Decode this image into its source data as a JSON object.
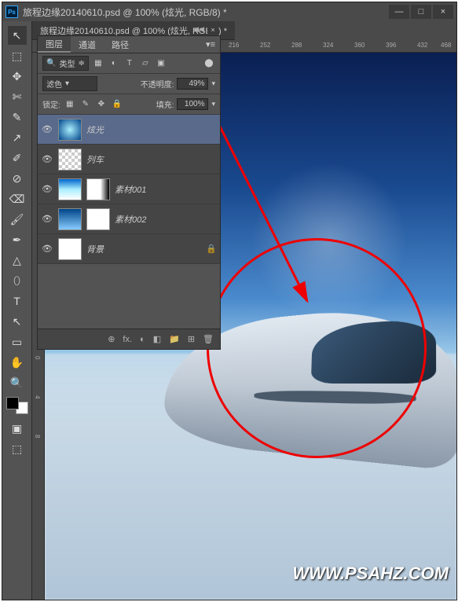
{
  "titlebar": {
    "app": "Ps",
    "title": "旅程边缘20140610.psd @ 100% (炫光, RGB/8) *"
  },
  "window_buttons": {
    "min": "—",
    "max": "□",
    "close": "×"
  },
  "tab_title": "旅程边缘20140610.psd @ 100% (炫光, RGB/8) *",
  "ruler_marks_h": [
    "216",
    "252",
    "288",
    "324",
    "360",
    "396",
    "432",
    "468"
  ],
  "ruler_marks_v": [
    "0",
    "4",
    "8"
  ],
  "panel": {
    "tabs": {
      "layers": "图层",
      "channels": "通道",
      "paths": "路径"
    },
    "filter_label": "类型",
    "filter_icon": "🔍",
    "blend_mode": "滤色",
    "opacity_label": "不透明度:",
    "opacity_value": "49%",
    "lock_label": "锁定:",
    "fill_label": "填充:",
    "fill_value": "100%",
    "layers": [
      {
        "name": "炫光",
        "selected": true
      },
      {
        "name": "列车"
      },
      {
        "name": "素材001"
      },
      {
        "name": "素材002"
      },
      {
        "name": "背景",
        "locked": true
      }
    ],
    "footer_icons": [
      "⊕",
      "fx.",
      "◐",
      "◧",
      "▣",
      "📁",
      "⊞",
      "🗑"
    ]
  },
  "tools": [
    "↖",
    "⬚",
    "✥",
    "✄",
    "✎",
    "↗",
    "✐",
    "⊘",
    "⌫",
    "🖌",
    "✒",
    "△",
    "⬯",
    "T",
    "↖",
    "▭",
    "✋",
    "🔍"
  ],
  "watermark": "WWW.PSAHZ.COM",
  "chart_data": null
}
